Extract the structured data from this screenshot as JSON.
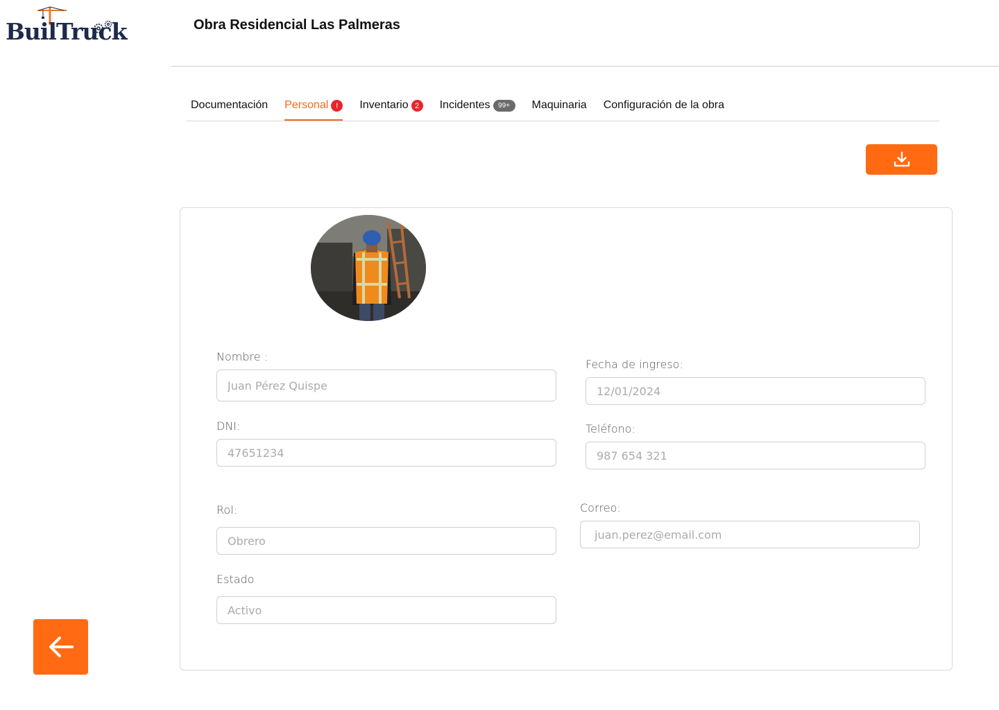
{
  "brand": {
    "logo_text": "BuilTruck"
  },
  "header": {
    "title": "Obra Residencial Las Palmeras"
  },
  "tabs": [
    {
      "label": "Documentación",
      "badge": ""
    },
    {
      "label": "Personal",
      "badge": "!"
    },
    {
      "label": "Inventario",
      "badge": "2"
    },
    {
      "label": "Incidentes",
      "badge": "99+"
    },
    {
      "label": "Maquinaria",
      "badge": ""
    },
    {
      "label": "Configuración de la obra",
      "badge": ""
    }
  ],
  "active_tab": "Personal",
  "actions": {
    "download_icon": "download-icon",
    "back_icon": "arrow-left-icon"
  },
  "form": {
    "nombre": {
      "label": "Nombre :",
      "placeholder": "Juan Pérez Quispe"
    },
    "dni": {
      "label": "DNI:",
      "placeholder": "47651234"
    },
    "rol": {
      "label": "Rol:",
      "placeholder": "Obrero"
    },
    "estado": {
      "label": "Estado",
      "placeholder": "Activo"
    },
    "fecha_ingreso": {
      "label": "Fecha de ingreso:",
      "placeholder": "12/01/2024"
    },
    "telefono": {
      "label": "Teléfono:",
      "placeholder": "987 654 321"
    },
    "correo": {
      "label": "Correo:",
      "placeholder": "juan.perez@email.com"
    }
  },
  "colors": {
    "accent": "#ff6a13",
    "brand_navy": "#1e2a4a",
    "badge_red": "#e5262c",
    "badge_gray": "#6a6a6a"
  }
}
